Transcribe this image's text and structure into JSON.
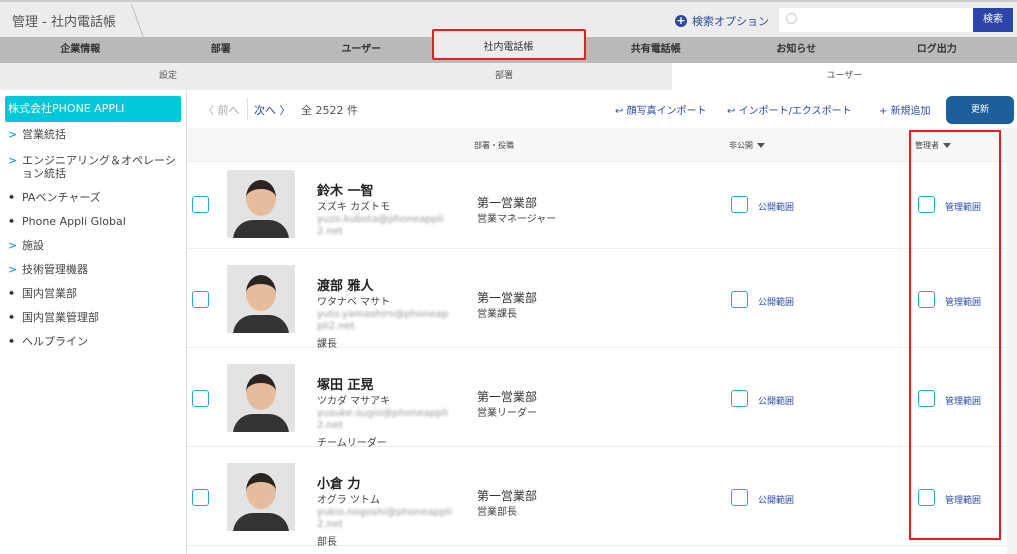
{
  "header": {
    "breadcrumb": "管理 - 社内電話帳",
    "search_options": "検索オプション",
    "search_placeholder": "",
    "search_button": "検索"
  },
  "nav": {
    "tabs": [
      "企業情報",
      "部署",
      "ユーザー",
      "社内電話帳",
      "共有電話帳",
      "お知らせ",
      "ログ出力"
    ],
    "active": "社内電話帳"
  },
  "subtabs": {
    "items": [
      "設定",
      "部署",
      "ユーザー"
    ],
    "active": "ユーザー"
  },
  "sidebar": {
    "company": "株式会社PHONE APPLI",
    "items": [
      {
        "label": "営業統括",
        "type": "expand"
      },
      {
        "label": "エンジニアリング＆オペレーション統括",
        "type": "expand"
      },
      {
        "label": "PAベンチャーズ",
        "type": "leaf"
      },
      {
        "label": "Phone Appli Global",
        "type": "leaf"
      },
      {
        "label": "施設",
        "type": "expand"
      },
      {
        "label": "技術管理機器",
        "type": "expand"
      },
      {
        "label": "国内営業部",
        "type": "leaf"
      },
      {
        "label": "国内営業管理部",
        "type": "leaf"
      },
      {
        "label": "ヘルプライン",
        "type": "leaf"
      }
    ]
  },
  "toolbar": {
    "prev": "前へ",
    "next": "次へ",
    "total": "全 2522 件",
    "photo_import": "顔写真インポート",
    "import_export": "インポート/エクスポート",
    "add_new": "新規追加",
    "update": "更新"
  },
  "table": {
    "headers": {
      "dept": "部署・役職",
      "private": "非公開",
      "admin": "管理者"
    },
    "rows": [
      {
        "name": "鈴木 一智",
        "kana": "スズキ カズトモ",
        "email": "yuzo.kubota@phoneappli2.net",
        "title": "",
        "dept": "第一営業部",
        "position": "営業マネージャー",
        "public_scope": "公開範囲",
        "admin_scope": "管理範囲"
      },
      {
        "name": "渡部 雅人",
        "kana": "ワタナベ マサト",
        "email": "yuto.yamashiro@phoneappli2.net",
        "title": "課長",
        "dept": "第一営業部",
        "position": "営業課長",
        "public_scope": "公開範囲",
        "admin_scope": "管理範囲"
      },
      {
        "name": "塚田 正晃",
        "kana": "ツカダ マサアキ",
        "email": "yusuke.sugio@phoneappli2.net",
        "title": "チームリーダー",
        "dept": "第一営業部",
        "position": "営業リーダー",
        "public_scope": "公開範囲",
        "admin_scope": "管理範囲"
      },
      {
        "name": "小倉 力",
        "kana": "オグラ ツトム",
        "email": "yukio.nogoshi@phoneappli2.net",
        "title": "部長",
        "dept": "第一営業部",
        "position": "営業部長",
        "public_scope": "公開範囲",
        "admin_scope": "管理範囲"
      }
    ]
  },
  "colors": {
    "accent": "#00c8d8",
    "primary": "#2b46a8",
    "highlight": "#e02020"
  }
}
